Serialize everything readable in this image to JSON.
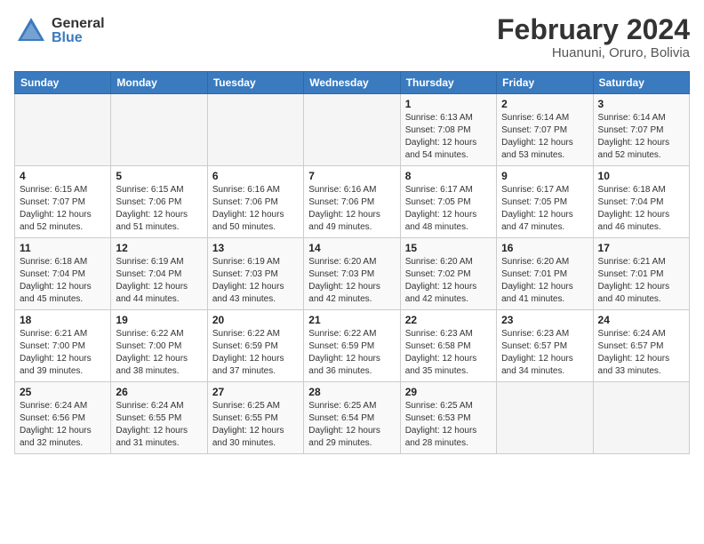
{
  "header": {
    "logo_general": "General",
    "logo_blue": "Blue",
    "title": "February 2024",
    "subtitle": "Huanuni, Oruro, Bolivia"
  },
  "weekdays": [
    "Sunday",
    "Monday",
    "Tuesday",
    "Wednesday",
    "Thursday",
    "Friday",
    "Saturday"
  ],
  "weeks": [
    [
      {
        "day": "",
        "info": ""
      },
      {
        "day": "",
        "info": ""
      },
      {
        "day": "",
        "info": ""
      },
      {
        "day": "",
        "info": ""
      },
      {
        "day": "1",
        "info": "Sunrise: 6:13 AM\nSunset: 7:08 PM\nDaylight: 12 hours and 54 minutes."
      },
      {
        "day": "2",
        "info": "Sunrise: 6:14 AM\nSunset: 7:07 PM\nDaylight: 12 hours and 53 minutes."
      },
      {
        "day": "3",
        "info": "Sunrise: 6:14 AM\nSunset: 7:07 PM\nDaylight: 12 hours and 52 minutes."
      }
    ],
    [
      {
        "day": "4",
        "info": "Sunrise: 6:15 AM\nSunset: 7:07 PM\nDaylight: 12 hours and 52 minutes."
      },
      {
        "day": "5",
        "info": "Sunrise: 6:15 AM\nSunset: 7:06 PM\nDaylight: 12 hours and 51 minutes."
      },
      {
        "day": "6",
        "info": "Sunrise: 6:16 AM\nSunset: 7:06 PM\nDaylight: 12 hours and 50 minutes."
      },
      {
        "day": "7",
        "info": "Sunrise: 6:16 AM\nSunset: 7:06 PM\nDaylight: 12 hours and 49 minutes."
      },
      {
        "day": "8",
        "info": "Sunrise: 6:17 AM\nSunset: 7:05 PM\nDaylight: 12 hours and 48 minutes."
      },
      {
        "day": "9",
        "info": "Sunrise: 6:17 AM\nSunset: 7:05 PM\nDaylight: 12 hours and 47 minutes."
      },
      {
        "day": "10",
        "info": "Sunrise: 6:18 AM\nSunset: 7:04 PM\nDaylight: 12 hours and 46 minutes."
      }
    ],
    [
      {
        "day": "11",
        "info": "Sunrise: 6:18 AM\nSunset: 7:04 PM\nDaylight: 12 hours and 45 minutes."
      },
      {
        "day": "12",
        "info": "Sunrise: 6:19 AM\nSunset: 7:04 PM\nDaylight: 12 hours and 44 minutes."
      },
      {
        "day": "13",
        "info": "Sunrise: 6:19 AM\nSunset: 7:03 PM\nDaylight: 12 hours and 43 minutes."
      },
      {
        "day": "14",
        "info": "Sunrise: 6:20 AM\nSunset: 7:03 PM\nDaylight: 12 hours and 42 minutes."
      },
      {
        "day": "15",
        "info": "Sunrise: 6:20 AM\nSunset: 7:02 PM\nDaylight: 12 hours and 42 minutes."
      },
      {
        "day": "16",
        "info": "Sunrise: 6:20 AM\nSunset: 7:01 PM\nDaylight: 12 hours and 41 minutes."
      },
      {
        "day": "17",
        "info": "Sunrise: 6:21 AM\nSunset: 7:01 PM\nDaylight: 12 hours and 40 minutes."
      }
    ],
    [
      {
        "day": "18",
        "info": "Sunrise: 6:21 AM\nSunset: 7:00 PM\nDaylight: 12 hours and 39 minutes."
      },
      {
        "day": "19",
        "info": "Sunrise: 6:22 AM\nSunset: 7:00 PM\nDaylight: 12 hours and 38 minutes."
      },
      {
        "day": "20",
        "info": "Sunrise: 6:22 AM\nSunset: 6:59 PM\nDaylight: 12 hours and 37 minutes."
      },
      {
        "day": "21",
        "info": "Sunrise: 6:22 AM\nSunset: 6:59 PM\nDaylight: 12 hours and 36 minutes."
      },
      {
        "day": "22",
        "info": "Sunrise: 6:23 AM\nSunset: 6:58 PM\nDaylight: 12 hours and 35 minutes."
      },
      {
        "day": "23",
        "info": "Sunrise: 6:23 AM\nSunset: 6:57 PM\nDaylight: 12 hours and 34 minutes."
      },
      {
        "day": "24",
        "info": "Sunrise: 6:24 AM\nSunset: 6:57 PM\nDaylight: 12 hours and 33 minutes."
      }
    ],
    [
      {
        "day": "25",
        "info": "Sunrise: 6:24 AM\nSunset: 6:56 PM\nDaylight: 12 hours and 32 minutes."
      },
      {
        "day": "26",
        "info": "Sunrise: 6:24 AM\nSunset: 6:55 PM\nDaylight: 12 hours and 31 minutes."
      },
      {
        "day": "27",
        "info": "Sunrise: 6:25 AM\nSunset: 6:55 PM\nDaylight: 12 hours and 30 minutes."
      },
      {
        "day": "28",
        "info": "Sunrise: 6:25 AM\nSunset: 6:54 PM\nDaylight: 12 hours and 29 minutes."
      },
      {
        "day": "29",
        "info": "Sunrise: 6:25 AM\nSunset: 6:53 PM\nDaylight: 12 hours and 28 minutes."
      },
      {
        "day": "",
        "info": ""
      },
      {
        "day": "",
        "info": ""
      }
    ]
  ]
}
